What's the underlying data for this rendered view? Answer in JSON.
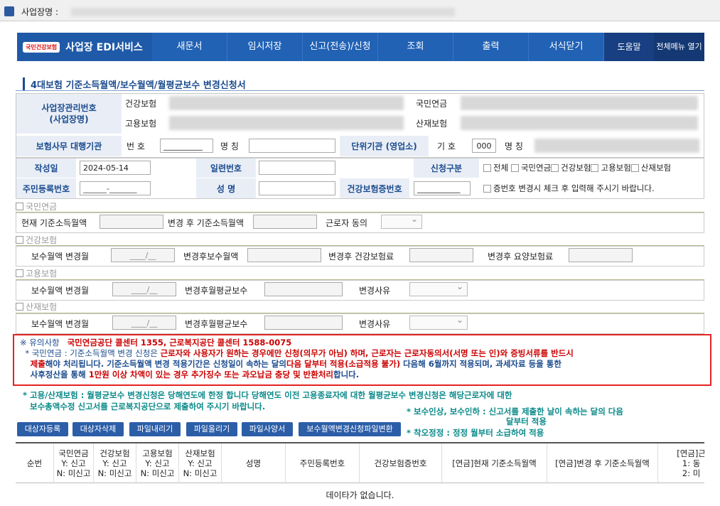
{
  "window": {
    "title_prefix": "사업장명 :"
  },
  "nav": {
    "brand_logo": "국민건강보험",
    "brand_name": "사업장 EDI서비스",
    "items": [
      "새문서",
      "임시저장",
      "신고(전송)/신청",
      "조회",
      "출력",
      "서식닫기"
    ],
    "help": "도움말",
    "all_menu": "전체메뉴 열기"
  },
  "page": {
    "title": "4대보험 기준소득월액/보수월액/월평균보수 변경신청서"
  },
  "biz": {
    "mgmt_label": "사업장관리번호\n(사업장명)",
    "health": "건강보험",
    "pension": "국민연금",
    "employment": "고용보험",
    "industrial": "산재보험",
    "agency_label": "보험사무 대행기관",
    "num_label": "번 호",
    "num_value": "__________",
    "name_label": "명 칭",
    "unit_label": "단위기관 (영업소)",
    "code_label": "기 호",
    "code_value": "000",
    "unit_name_label": "명 칭"
  },
  "form": {
    "date_label": "작성일",
    "date_value": "2024-05-14",
    "serial_label": "일련번호",
    "type_label": "신청구분",
    "types": [
      "전체",
      "국민연금",
      "건강보험",
      "고용보험",
      "산재보험"
    ],
    "rrn_label": "주민등록번호",
    "rrn_value": "______-_______",
    "name_label": "성 명",
    "hic_label": "건강보험증번호",
    "hic_value": "___________",
    "hic_note": "증번호 변경시 체크 후 입력해 주시기 바랍니다."
  },
  "sections": {
    "pension": {
      "title": "국민연금",
      "cur": "현재 기준소득월액",
      "after": "변경 후 기준소득월액",
      "consent": "근로자 동의"
    },
    "health": {
      "title": "건강보험",
      "month": "보수월액 변경월",
      "month_value": "____/__",
      "salary": "변경후보수월액",
      "premium": "변경후 건강보험료",
      "ltc": "변경후 요양보험료"
    },
    "employment": {
      "title": "고용보험",
      "month": "보수월액 변경월",
      "month_value": "____/__",
      "avg": "변경후월평균보수",
      "reason": "변경사유"
    },
    "industrial": {
      "title": "산재보험",
      "month": "보수월액 변경월",
      "month_value": "____/__",
      "avg": "변경후월평균보수",
      "reason": "변경사유"
    }
  },
  "notice": {
    "head": "※ 유의사항",
    "callcenter": "국민연금공단 콜센터 1355, 근로복지공단 콜센터 1588-0075",
    "l1a": "* 국민연금 : 기준소득월액 변경 신청은 ",
    "l1b": "근로자와 사용자가 원하는 경우에만 신청(의무가 아님) 하며, 근로자는 근로자동의서(서명 또는 인)와 증빙서류를 반드시",
    "l2a": "제출",
    "l2b": "해야 처리됩니다. 기준소득월액 변경 적용기간은 신청일이 속하는 달의",
    "l2c": "다음 달부터 적용(소급적용 불가)",
    "l2d": " 다음해 6월까지 적용되며, 과세자료 등을 통한",
    "l3a": "사후정산을 통해 ",
    "l3b": "1만원 이상 차액이 있는 경우 추가징수 또는 과오납금 충당 및 반환처리",
    "l3c": "합니다."
  },
  "info": {
    "emp1": "* 고용/산재보험 : 월평균보수 변경신청은 당해연도에 한정 합니다 당해연도 이전 고용종료자에 대한 월평균보수 변경신청은 해당근로자에 대한",
    "emp2": "보수총액수정 신고서를 근로복지공단으로 제출하여 주시기 바랍니다.",
    "raise1": "* 보수인상, 보수인하 : 신고서를 제출한 날이 속하는 달의 다음",
    "raise2": "달부터 적용",
    "error": "* 착오정정 : 정정 월부터 소급하여 적용"
  },
  "buttons": [
    "대상자등록",
    "대상자삭제",
    "파일내리기",
    "파일올리기",
    "파일사양서",
    "보수월액변경신청파일변환"
  ],
  "grid": {
    "headers": [
      "순번",
      "국민연금\nY: 신고\nN: 미신고",
      "건강보험\nY: 신고\nN: 미신고",
      "고용보험\nY: 신고\nN: 미신고",
      "산재보험\nY: 신고\nN: 미신고",
      "성명",
      "주민등록번호",
      "건강보험증번호",
      "[연금]현재 기준소득월액",
      "[연금]변경 후 기준소득월액",
      "[연금]근\n1: 동\n2: 미"
    ],
    "empty": "데이타가 없습니다."
  }
}
